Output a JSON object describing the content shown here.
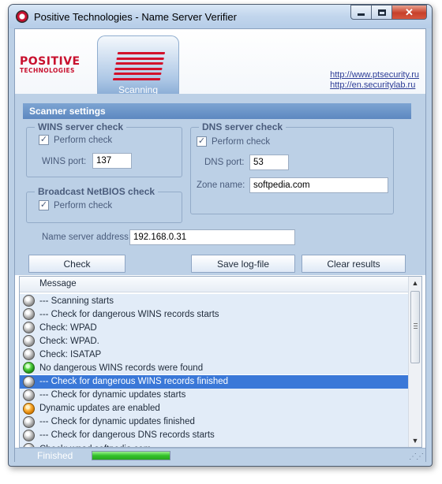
{
  "window": {
    "title": "Positive Technologies - Name Server Verifier"
  },
  "header": {
    "logo_top": "POSITIVE",
    "logo_bottom": "TECHNOLOGIES",
    "tab_label": "Scanning",
    "links": [
      "http://www.ptsecurity.ru",
      "http://en.securitylab.ru"
    ]
  },
  "settings": {
    "title": "Scanner settings",
    "wins": {
      "title": "WINS server check",
      "perform_label": "Perform check",
      "perform_checked": true,
      "port_label": "WINS port:",
      "port_value": "137"
    },
    "netbios": {
      "title": "Broadcast NetBIOS check",
      "perform_label": "Perform check",
      "perform_checked": true
    },
    "dns": {
      "title": "DNS server check",
      "perform_label": "Perform check",
      "perform_checked": true,
      "port_label": "DNS port:",
      "port_value": "53",
      "zone_label": "Zone name:",
      "zone_value": "softpedia.com"
    },
    "address_label": "Name server address:",
    "address_value": "192.168.0.31"
  },
  "buttons": {
    "check": "Check",
    "save_log": "Save log-file",
    "clear": "Clear results"
  },
  "log": {
    "column_header": "Message",
    "rows": [
      {
        "status": "gray",
        "text": "--- Scanning starts"
      },
      {
        "status": "gray",
        "text": "--- Check for dangerous WINS records starts"
      },
      {
        "status": "gray",
        "text": "Check: WPAD"
      },
      {
        "status": "gray",
        "text": "Check: WPAD."
      },
      {
        "status": "gray",
        "text": "Check: ISATAP"
      },
      {
        "status": "green",
        "text": "No dangerous WINS records were found"
      },
      {
        "status": "gray",
        "text": "--- Check for dangerous WINS records finished",
        "selected": true
      },
      {
        "status": "gray",
        "text": "--- Check for dynamic updates starts"
      },
      {
        "status": "orange",
        "text": "Dynamic updates are enabled"
      },
      {
        "status": "gray",
        "text": "--- Check for dynamic updates finished"
      },
      {
        "status": "gray",
        "text": "--- Check for dangerous DNS records starts"
      },
      {
        "status": "gray",
        "text": "Check: wpad.softpedia.com"
      }
    ]
  },
  "status": {
    "text": "Finished",
    "progress": 1.0
  }
}
